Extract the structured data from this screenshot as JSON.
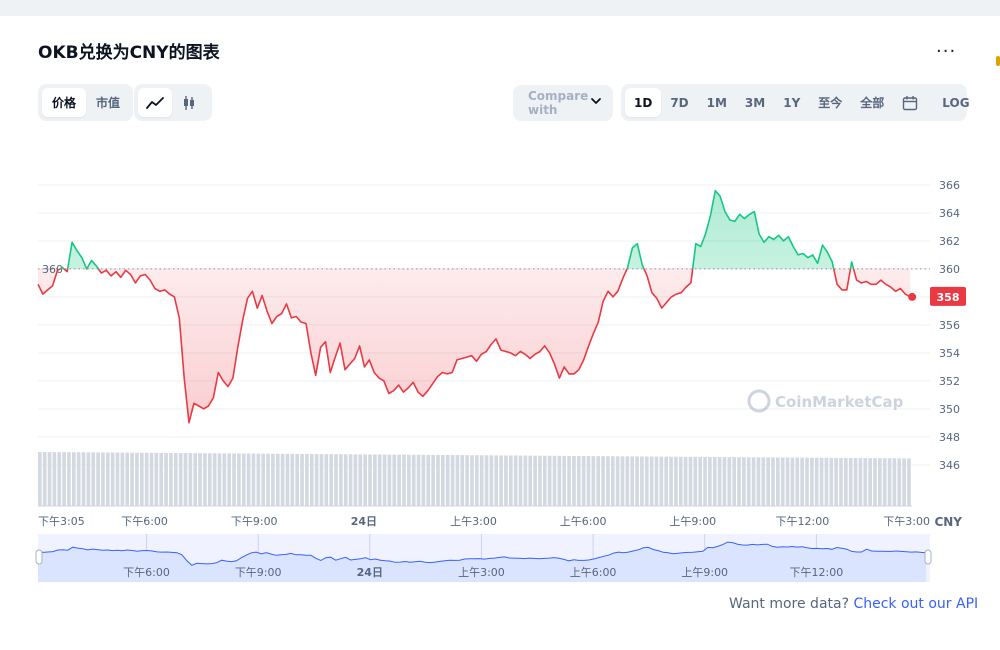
{
  "header": {
    "title": "OKB兑换为CNY的图表",
    "more_label": "..."
  },
  "toolbar": {
    "price_label": "价格",
    "market_cap_label": "市值",
    "line_icon": "line-chart-icon",
    "candle_icon": "candlestick-icon",
    "compare_label": "Compare with",
    "ranges": [
      "1D",
      "7D",
      "1M",
      "3M",
      "1Y",
      "至今",
      "全部"
    ],
    "active_range": "1D",
    "calendar_icon": "calendar-icon",
    "log_label": "LOG"
  },
  "footer": {
    "text": "Want more data? ",
    "link": "Check out our API"
  },
  "watermark": "CoinMarketCap",
  "colors": {
    "up": "#16c784",
    "down": "#ea3943",
    "volume": "#d3d8e1",
    "navigator_fill": "#dbe4ff",
    "navigator_line": "#3861fb",
    "link": "#3861fb"
  },
  "chart_data": {
    "type": "line",
    "title": "",
    "currency_label": "CNY",
    "baseline": 360,
    "baseline_label": "360",
    "last_value": 358,
    "last_label": "358",
    "ylim": [
      344.2,
      368.5
    ],
    "y_ticks": [
      366,
      364,
      362,
      360,
      358,
      356,
      354,
      352,
      350,
      348,
      346
    ],
    "x_range": [
      0,
      1435
    ],
    "x_ticks": [
      {
        "t": 0,
        "label": "下午3:05"
      },
      {
        "t": 175,
        "label": "下午6:00"
      },
      {
        "t": 355,
        "label": "下午9:00"
      },
      {
        "t": 535,
        "label": "24日",
        "bold": true
      },
      {
        "t": 715,
        "label": "上午3:00"
      },
      {
        "t": 895,
        "label": "上午6:00"
      },
      {
        "t": 1075,
        "label": "上午9:00"
      },
      {
        "t": 1255,
        "label": "下午12:00"
      },
      {
        "t": 1435,
        "label": "下午3:00"
      }
    ],
    "series": [
      {
        "x": [
          0,
          8,
          16,
          24,
          32,
          40,
          48,
          56,
          64,
          72,
          80,
          88,
          96,
          104,
          112,
          120,
          128,
          136,
          144,
          152,
          160,
          168,
          176,
          184,
          192,
          200,
          208,
          216,
          224,
          232,
          240,
          248,
          256,
          264,
          272,
          280,
          288,
          296,
          304,
          312,
          320,
          328,
          336,
          344,
          352,
          360,
          368,
          376,
          384,
          392,
          400,
          408,
          416,
          424,
          432,
          440,
          448,
          456,
          464,
          472,
          480,
          488,
          496,
          504,
          512,
          520,
          528,
          536,
          544,
          552,
          560,
          568,
          576,
          584,
          592,
          600,
          608,
          616,
          624,
          632,
          640,
          648,
          656,
          664,
          672,
          680,
          688,
          696,
          704,
          712,
          720,
          728,
          736,
          744,
          752,
          760,
          768,
          776,
          784,
          792,
          800,
          808,
          816,
          824,
          832,
          840,
          848,
          856,
          864,
          872,
          880,
          888,
          896,
          904,
          912,
          920,
          928,
          936,
          944,
          952,
          960,
          968,
          976,
          984,
          992,
          1000,
          1008,
          1016,
          1024,
          1032,
          1040,
          1048,
          1056,
          1064,
          1072,
          1080,
          1088,
          1096,
          1104,
          1112,
          1120,
          1128,
          1136,
          1144,
          1152,
          1160,
          1168,
          1176,
          1184,
          1192,
          1200,
          1208,
          1216,
          1224,
          1232,
          1240,
          1248,
          1256,
          1264,
          1272,
          1280,
          1288,
          1296,
          1304,
          1312,
          1320,
          1328,
          1336,
          1344,
          1352,
          1360,
          1368,
          1376,
          1384,
          1392,
          1400,
          1408,
          1416,
          1424,
          1432
        ],
        "y": [
          358.9,
          358.2,
          358.5,
          358.8,
          359.9,
          360.1,
          359.8,
          361.9,
          361.3,
          360.8,
          360.0,
          360.6,
          360.2,
          359.7,
          359.9,
          359.5,
          359.8,
          359.4,
          359.9,
          359.6,
          359.0,
          359.5,
          359.6,
          359.2,
          358.6,
          358.4,
          358.5,
          358.2,
          358.0,
          356.5,
          352.2,
          349.0,
          350.4,
          350.2,
          350.0,
          350.2,
          350.8,
          352.6,
          352.0,
          351.6,
          352.2,
          354.4,
          356.3,
          357.9,
          358.4,
          357.2,
          358.1,
          357.0,
          356.1,
          356.6,
          356.8,
          357.5,
          356.5,
          356.6,
          356.2,
          356.1,
          354.0,
          352.4,
          354.4,
          354.8,
          352.6,
          353.7,
          354.7,
          352.8,
          353.2,
          353.6,
          354.5,
          353.0,
          353.5,
          352.6,
          352.2,
          352.0,
          351.1,
          351.3,
          351.7,
          351.2,
          351.5,
          351.9,
          351.2,
          350.9,
          351.3,
          351.8,
          352.3,
          352.6,
          352.5,
          352.6,
          353.5,
          353.6,
          353.7,
          353.8,
          353.4,
          353.9,
          354.1,
          354.6,
          355.0,
          354.2,
          354.1,
          354.0,
          353.8,
          354.1,
          353.9,
          353.6,
          353.9,
          354.1,
          354.5,
          354.0,
          353.2,
          352.2,
          353.0,
          352.5,
          352.5,
          352.8,
          353.5,
          354.5,
          355.4,
          356.2,
          357.7,
          358.4,
          358.0,
          358.4,
          359.3,
          360.1,
          361.5,
          361.8,
          360.3,
          359.5,
          358.3,
          357.9,
          357.2,
          357.6,
          358.0,
          358.2,
          358.3,
          358.7,
          359.0,
          361.8,
          361.6,
          362.5,
          363.8,
          365.6,
          365.2,
          364.1,
          363.5,
          363.4,
          363.9,
          363.6,
          363.9,
          364.1,
          362.5,
          361.9,
          362.3,
          362.1,
          362.4,
          362.0,
          362.3,
          361.6,
          361.0,
          361.1,
          360.8,
          361.0,
          360.4,
          361.7,
          361.2,
          360.5,
          358.9,
          358.5,
          358.5,
          360.5,
          359.2,
          359.0,
          359.1,
          358.9,
          358.9,
          359.2,
          358.9,
          358.7,
          358.4,
          358.6,
          358.2,
          358.0
        ]
      }
    ],
    "volume": [
      20,
      20,
      20,
      20,
      20,
      20,
      20,
      20,
      20,
      20,
      20,
      20,
      20,
      20,
      20,
      20,
      20,
      20,
      20,
      20,
      20,
      20,
      20,
      20,
      20,
      20,
      20,
      20,
      20,
      20,
      20,
      20,
      20,
      20,
      20,
      20,
      20,
      20,
      20,
      20,
      20,
      20,
      20,
      20,
      20,
      20,
      20,
      20,
      20,
      20,
      20,
      20,
      20,
      20,
      20,
      20,
      20,
      20,
      20,
      20,
      20,
      20,
      20,
      20,
      20,
      20,
      20,
      20,
      20,
      20,
      20,
      20,
      20,
      20,
      20,
      20,
      20,
      20,
      20,
      20,
      20,
      20,
      20,
      20,
      20,
      20,
      20,
      20,
      20,
      20,
      20,
      20,
      20,
      20,
      20,
      20,
      20,
      20,
      20,
      20,
      20,
      20,
      20,
      20,
      20,
      20,
      20,
      20,
      20,
      20,
      20,
      20,
      20,
      20,
      20,
      20,
      20,
      20,
      20,
      20,
      20,
      20,
      20,
      20,
      20,
      20,
      20,
      20,
      20,
      20,
      20,
      20,
      20,
      20,
      20,
      20,
      20,
      20,
      20,
      20,
      20,
      20,
      20,
      20,
      20,
      20,
      20,
      20,
      20,
      20,
      20,
      20,
      20,
      20,
      20,
      20,
      20,
      20,
      20,
      20,
      20,
      20,
      20,
      20,
      20,
      20,
      20,
      20,
      20,
      20,
      20,
      20,
      20,
      20,
      20,
      20,
      20,
      20,
      20,
      20
    ],
    "navigator": {
      "x_ticks": [
        {
          "t": 175,
          "label": "下午6:00"
        },
        {
          "t": 355,
          "label": "下午9:00"
        },
        {
          "t": 535,
          "label": "24日",
          "bold": true
        },
        {
          "t": 715,
          "label": "上午3:00"
        },
        {
          "t": 895,
          "label": "上午6:00"
        },
        {
          "t": 1075,
          "label": "上午9:00"
        },
        {
          "t": 1255,
          "label": "下午12:00"
        }
      ]
    }
  }
}
